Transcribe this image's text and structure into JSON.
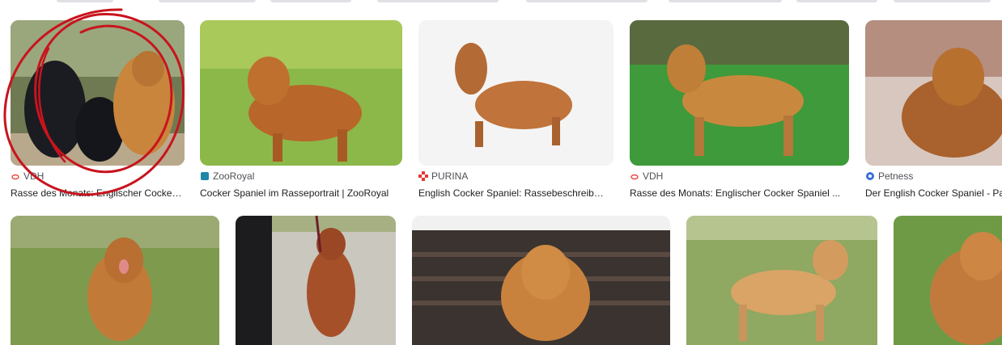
{
  "results_row1": [
    {
      "source": "VDH",
      "title": "Rasse des Monats: Englischer Cocker Spaniel",
      "favicon": "vdh-paw-icon",
      "color": "#e8453c"
    },
    {
      "source": "ZooRoyal",
      "title": "Cocker Spaniel im Rasseportrait | ZooRoyal",
      "favicon": "zooroyal-icon",
      "color": "#1e88a8"
    },
    {
      "source": "PURINA",
      "title": "English Cocker Spaniel: Rassebeschreibung",
      "favicon": "purina-checker-icon",
      "color": "#e53935"
    },
    {
      "source": "VDH",
      "title": "Rasse des Monats: Englischer Cocker Spaniel ...",
      "favicon": "vdh-paw-icon",
      "color": "#e8453c"
    },
    {
      "source": "Petness",
      "title": "Der English Cocker Spaniel - Pa",
      "favicon": "petness-icon",
      "color": "#3b6fd8"
    }
  ],
  "results_row2": [
    {
      "alt": "cocker spaniel sitting on grass"
    },
    {
      "alt": "cocker spaniel on leash"
    },
    {
      "alt": "cocker spaniel on bench"
    },
    {
      "alt": "cocker spaniel standing on grass"
    },
    {
      "alt": "cocker spaniel close up"
    }
  ],
  "annotation": {
    "color": "#c8141e",
    "label": "red-hand-drawn-circle"
  }
}
